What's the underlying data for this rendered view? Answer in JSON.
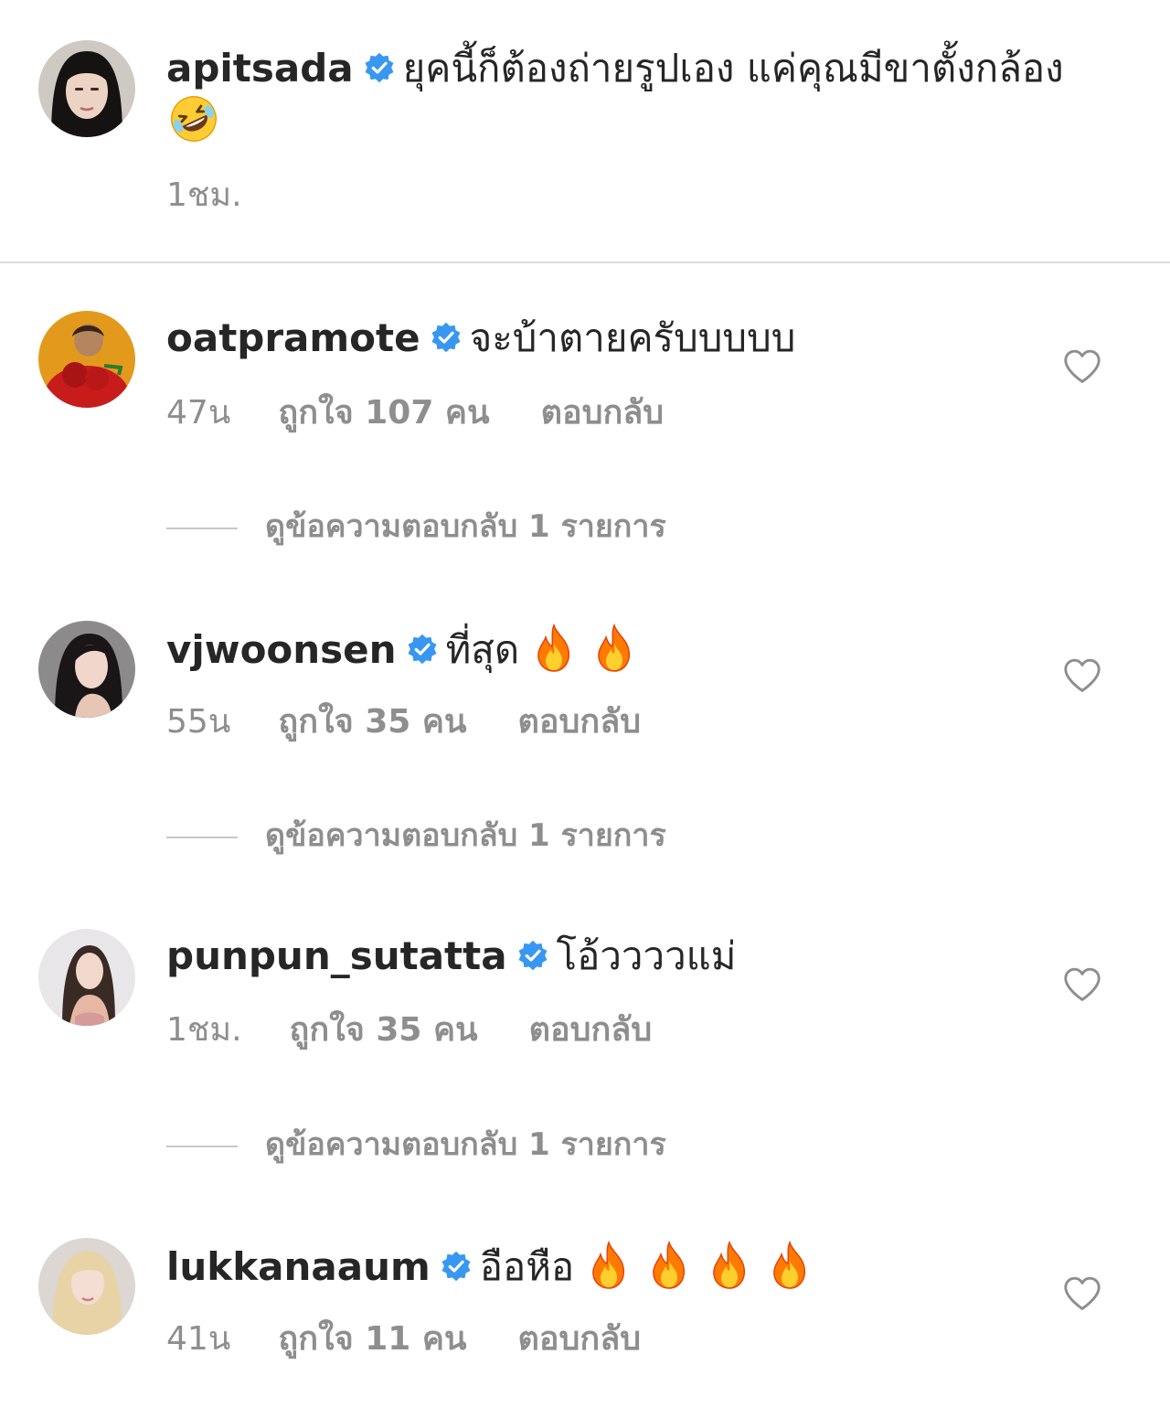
{
  "caption": {
    "username": "apitsada",
    "text": "ยุคนี้ก็ต้องถ่ายรูปเอง แค่คุณมีขาตั้งกล้อง",
    "emoji": "rolling-on-floor-laughing-emoji",
    "time": "1ชม."
  },
  "comments": [
    {
      "username": "oatpramote",
      "text": "จะบ้าตายครับบบบบ",
      "emojis": [],
      "time": "47น",
      "likes": "ถูกใจ 107 คน",
      "reply": "ตอบกลับ",
      "view_replies": "ดูข้อความตอบกลับ 1 รายการ"
    },
    {
      "username": "vjwoonsen",
      "text": "ที่สุด",
      "emojis": [
        "fire-emoji",
        "fire-emoji"
      ],
      "time": "55น",
      "likes": "ถูกใจ 35 คน",
      "reply": "ตอบกลับ",
      "view_replies": "ดูข้อความตอบกลับ 1 รายการ"
    },
    {
      "username": "punpun_sutatta",
      "text": "โอ้ววววแม่",
      "emojis": [],
      "time": "1ชม.",
      "likes": "ถูกใจ 35 คน",
      "reply": "ตอบกลับ",
      "view_replies": "ดูข้อความตอบกลับ 1 รายการ"
    },
    {
      "username": "lukkanaaum",
      "text": "อือหือ",
      "emojis": [
        "fire-emoji",
        "fire-emoji",
        "fire-emoji",
        "fire-emoji"
      ],
      "time": "41น",
      "likes": "ถูกใจ 11 คน",
      "reply": "ตอบกลับ"
    }
  ],
  "colors": {
    "text": "#262626",
    "secondary": "#8e8e8e",
    "verified": "#3897f0",
    "divider": "#dbdbdb"
  }
}
